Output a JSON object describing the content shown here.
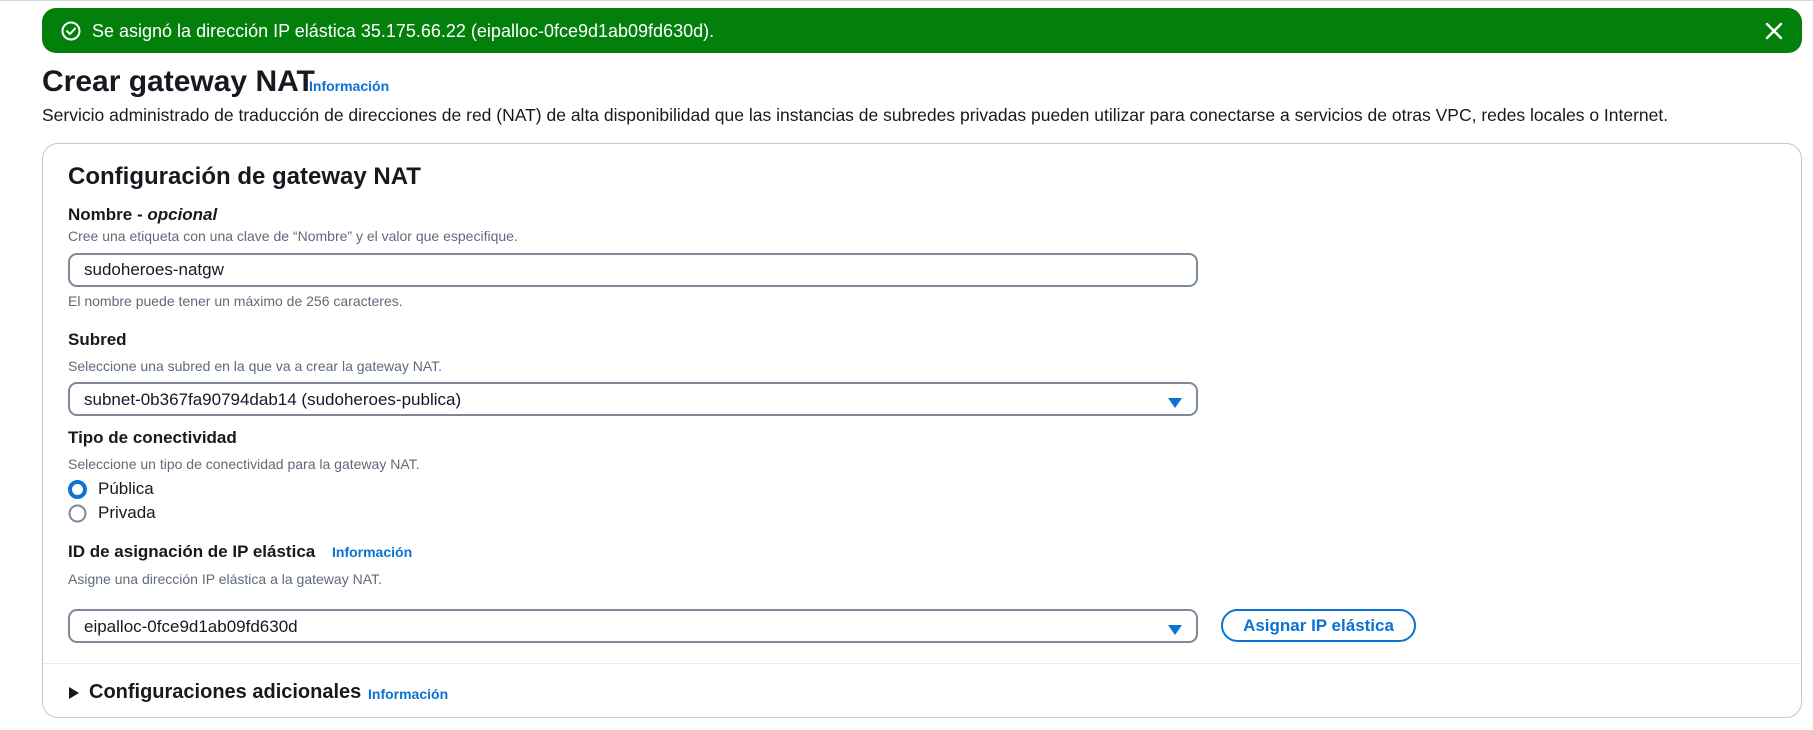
{
  "flash": {
    "message": "Se asignó la dirección IP elástica 35.175.66.22 (eipalloc-0fce9d1ab09fd630d).",
    "color": "#037f0c"
  },
  "header": {
    "title": "Crear gateway NAT",
    "info_link": "Información",
    "description": "Servicio administrado de traducción de direcciones de red (NAT) de alta disponibilidad que las instancias de subredes privadas pueden utilizar para conectarse a servicios de otras VPC, redes locales o Internet."
  },
  "config": {
    "title": "Configuración de gateway NAT",
    "name": {
      "label": "Nombre",
      "optional": "opcional",
      "description": "Cree una etiqueta con una clave de “Nombre” y el valor que especifique.",
      "value": "sudoheroes-natgw",
      "constraint": "El nombre puede tener un máximo de 256 caracteres."
    },
    "subnet": {
      "label": "Subred",
      "description": "Seleccione una subred en la que va a crear la gateway NAT.",
      "selected": "subnet-0b367fa90794dab14 (sudoheroes-publica)"
    },
    "connectivity": {
      "label": "Tipo de conectividad",
      "description": "Seleccione un tipo de conectividad para la gateway NAT.",
      "options": [
        {
          "label": "Pública",
          "selected": true
        },
        {
          "label": "Privada",
          "selected": false
        }
      ]
    },
    "eip": {
      "label": "ID de asignación de IP elástica",
      "info_link": "Información",
      "description": "Asigne una dirección IP elástica a la gateway NAT.",
      "selected": "eipalloc-0fce9d1ab09fd630d",
      "allocate_button": "Asignar IP elástica"
    },
    "additional": {
      "title": "Configuraciones adicionales",
      "info_link": "Información"
    }
  },
  "colors": {
    "accent": "#0972d3",
    "success": "#037f0c",
    "text": "#16191f",
    "muted": "#5f6b7a"
  }
}
